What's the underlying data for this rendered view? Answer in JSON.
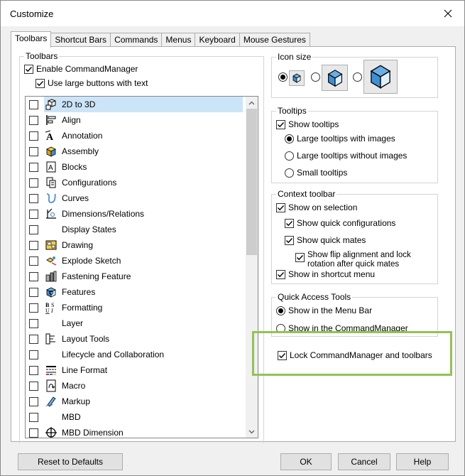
{
  "window": {
    "title": "Customize"
  },
  "tabs": [
    "Toolbars",
    "Shortcut Bars",
    "Commands",
    "Menus",
    "Keyboard",
    "Mouse Gestures"
  ],
  "toolbars_group": {
    "title": "Toolbars",
    "enable_commandmanager": "Enable CommandManager",
    "use_large_buttons": "Use large buttons with text",
    "items": [
      {
        "label": "2D to 3D",
        "icon": "2d-to-3d-icon"
      },
      {
        "label": "Align",
        "icon": "align-icon"
      },
      {
        "label": "Annotation",
        "icon": "annotation-icon"
      },
      {
        "label": "Assembly",
        "icon": "assembly-icon"
      },
      {
        "label": "Blocks",
        "icon": "blocks-icon"
      },
      {
        "label": "Configurations",
        "icon": "configurations-icon"
      },
      {
        "label": "Curves",
        "icon": "curves-icon"
      },
      {
        "label": "Dimensions/Relations",
        "icon": "dimensions-relations-icon"
      },
      {
        "label": "Display States",
        "icon": ""
      },
      {
        "label": "Drawing",
        "icon": "drawing-icon"
      },
      {
        "label": "Explode Sketch",
        "icon": "explode-sketch-icon"
      },
      {
        "label": "Fastening Feature",
        "icon": "fastening-feature-icon"
      },
      {
        "label": "Features",
        "icon": "features-icon"
      },
      {
        "label": "Formatting",
        "icon": "formatting-icon"
      },
      {
        "label": "Layer",
        "icon": ""
      },
      {
        "label": "Layout Tools",
        "icon": "layout-tools-icon"
      },
      {
        "label": "Lifecycle and Collaboration",
        "icon": ""
      },
      {
        "label": "Line Format",
        "icon": "line-format-icon"
      },
      {
        "label": "Macro",
        "icon": "macro-icon"
      },
      {
        "label": "Markup",
        "icon": "markup-icon"
      },
      {
        "label": "MBD",
        "icon": ""
      },
      {
        "label": "MBD Dimension",
        "icon": "mbd-dimension-icon"
      }
    ]
  },
  "icon_size": {
    "title": "Icon size"
  },
  "tooltips": {
    "title": "Tooltips",
    "show_tooltips": "Show tooltips",
    "large_with_images": "Large tooltips with images",
    "large_without_images": "Large tooltips without images",
    "small": "Small tooltips"
  },
  "context_toolbar": {
    "title": "Context toolbar",
    "show_on_selection": "Show on selection",
    "show_quick_configurations": "Show quick configurations",
    "show_quick_mates": "Show quick mates",
    "show_flip_line1": "Show flip alignment and lock",
    "show_flip_line2": "rotation after quick mates",
    "show_in_shortcut_menu": "Show in shortcut menu"
  },
  "quick_access": {
    "title": "Quick Access Tools",
    "menu_bar": "Show in the Menu Bar",
    "commandmanager": "Show in the CommandManager"
  },
  "lock": {
    "label": "Lock CommandManager and toolbars"
  },
  "buttons": {
    "reset": "Reset to Defaults",
    "ok": "OK",
    "cancel": "Cancel",
    "help": "Help"
  },
  "colors": {
    "selection": "#cce4f7",
    "highlight": "#92c353",
    "accent_blue": "#2b7bd6"
  }
}
